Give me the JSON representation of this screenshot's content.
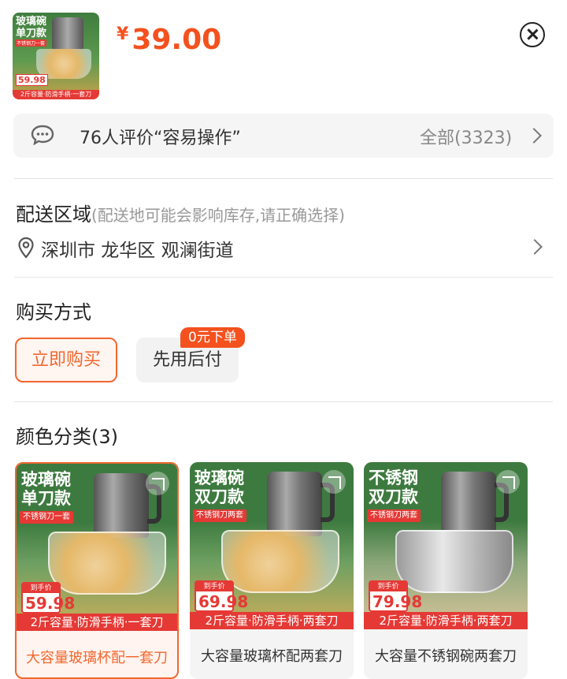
{
  "product": {
    "thumb_tag_line1": "玻璃碗",
    "thumb_tag_line2": "单刀款",
    "thumb_red_tag": "不锈钢刀一套",
    "thumb_price": "59.98",
    "thumb_strip": "2斤容量·防滑手柄·一套刀",
    "currency": "¥",
    "price": "39.00"
  },
  "reviews": {
    "summary": "76人评价“容易操作”",
    "all_label": "全部(3323)"
  },
  "delivery": {
    "title": "配送区域",
    "hint": "(配送地可能会影响库存,请正确选择)",
    "address": "深圳市 龙华区 观澜街道"
  },
  "purchase": {
    "title": "购买方式",
    "options": [
      {
        "label": "立即购买",
        "selected": true
      },
      {
        "label": "先用后付",
        "badge": "0元下单",
        "selected": false
      }
    ]
  },
  "colors": {
    "title": "颜色分类(3)",
    "items": [
      {
        "tag": "玻璃碗\n单刀款",
        "red_tag": "不锈钢刀一套",
        "price_label": "到手价",
        "price": "59.98",
        "strip": "2斤容量·防滑手柄·一套刀",
        "name": "大容量玻璃杯配一套刀",
        "bowl": "glass",
        "selected": true
      },
      {
        "tag": "玻璃碗\n双刀款",
        "red_tag": "不锈钢刀两套",
        "price_label": "到手价",
        "price": "69.98",
        "strip": "2斤容量·防滑手柄·两套刀",
        "name": "大容量玻璃杯配两套刀",
        "bowl": "glass",
        "selected": false
      },
      {
        "tag": "不锈钢\n双刀款",
        "red_tag": "不锈钢刀两套",
        "price_label": "到手价",
        "price": "79.98",
        "strip": "2斤容量·防滑手柄·两套刀",
        "name": "大容量不锈钢碗两套刀",
        "bowl": "steel",
        "selected": false
      }
    ]
  },
  "theme": {
    "accent": "#f4511e",
    "selected_border": "#f2672f",
    "product_green": "#3d7a3f",
    "strip_red": "#e53935"
  }
}
